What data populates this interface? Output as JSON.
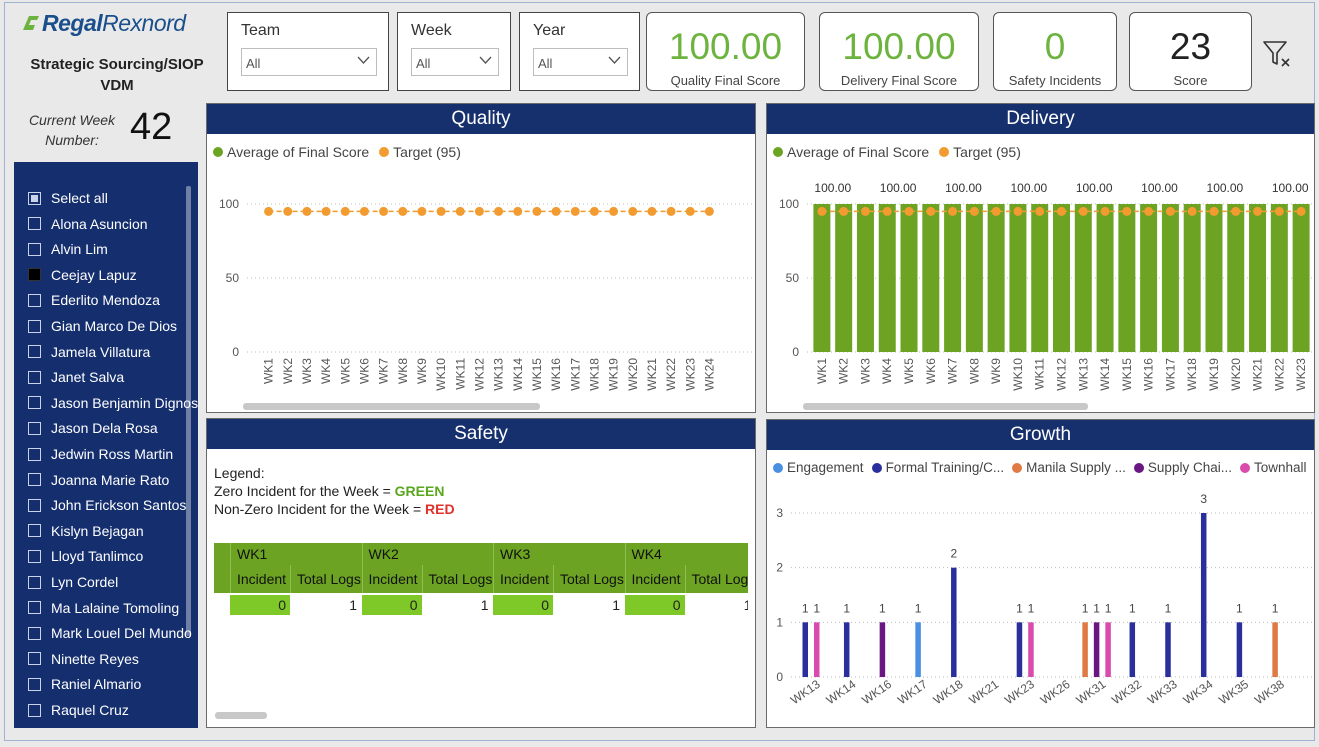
{
  "header": {
    "logo_text_bold": "Regal",
    "logo_text_rest": "Rexnord",
    "org_title": "Strategic Sourcing/SIOP VDM",
    "current_week_label": "Current Week Number:",
    "current_week_value": "42"
  },
  "slicers": [
    {
      "label": "Team",
      "value": "All"
    },
    {
      "label": "Week",
      "value": "All"
    },
    {
      "label": "Year",
      "value": "All"
    }
  ],
  "cards": [
    {
      "value": "100.00",
      "label": "Quality Final Score"
    },
    {
      "value": "100.00",
      "label": "Delivery Final Score"
    },
    {
      "value": "0",
      "label": "Safety Incidents"
    },
    {
      "value": "23",
      "label": "Score"
    }
  ],
  "people": {
    "items": [
      {
        "label": "Select all",
        "state": "partial"
      },
      {
        "label": "Alona Asuncion",
        "state": "none"
      },
      {
        "label": "Alvin Lim",
        "state": "none"
      },
      {
        "label": "Ceejay Lapuz",
        "state": "checked"
      },
      {
        "label": "Ederlito Mendoza",
        "state": "none"
      },
      {
        "label": "Gian Marco De Dios",
        "state": "none"
      },
      {
        "label": "Jamela Villatura",
        "state": "none"
      },
      {
        "label": "Janet Salva",
        "state": "none"
      },
      {
        "label": "Jason Benjamin Dignos",
        "state": "none"
      },
      {
        "label": "Jason Dela Rosa",
        "state": "none"
      },
      {
        "label": "Jedwin Ross Martin",
        "state": "none"
      },
      {
        "label": "Joanna Marie Rato",
        "state": "none"
      },
      {
        "label": "John Erickson Santos",
        "state": "none"
      },
      {
        "label": "Kislyn Bejagan",
        "state": "none"
      },
      {
        "label": "Lloyd Tanlimco",
        "state": "none"
      },
      {
        "label": "Lyn Cordel",
        "state": "none"
      },
      {
        "label": "Ma Lalaine Tomoling",
        "state": "none"
      },
      {
        "label": "Mark Louel Del Mundo",
        "state": "none"
      },
      {
        "label": "Ninette Reyes",
        "state": "none"
      },
      {
        "label": "Raniel Almario",
        "state": "none"
      },
      {
        "label": "Raquel Cruz",
        "state": "none"
      }
    ]
  },
  "colors": {
    "navy": "#162f6d",
    "score_green": "#6db33f",
    "bar_green": "#6ca322",
    "target_orange": "#f29b30",
    "avg_green": "#6ca322"
  },
  "panels": {
    "quality": {
      "title": "Quality"
    },
    "delivery": {
      "title": "Delivery"
    },
    "safety": {
      "title": "Safety"
    },
    "growth": {
      "title": "Growth"
    }
  },
  "safety": {
    "legend_title": "Legend:",
    "line1_prefix": "Zero Incident for the Week = ",
    "line1_value": "GREEN",
    "line2_prefix": "Non-Zero Incident for the Week = ",
    "line2_value": "RED",
    "weeks": [
      "WK1",
      "WK2",
      "WK3",
      "WK4"
    ],
    "col_headers": [
      "Incident",
      "Total Logs"
    ],
    "values": [
      {
        "incident": "0",
        "logs": "1"
      },
      {
        "incident": "0",
        "logs": "1"
      },
      {
        "incident": "0",
        "logs": "1"
      },
      {
        "incident": "0",
        "logs": "1"
      }
    ]
  },
  "chart_data": [
    {
      "id": "quality",
      "type": "line",
      "title": "Quality",
      "series": [
        {
          "name": "Average of Final Score",
          "values": []
        },
        {
          "name": "Target (95)",
          "values": [
            95,
            95,
            95,
            95,
            95,
            95,
            95,
            95,
            95,
            95,
            95,
            95,
            95,
            95,
            95,
            95,
            95,
            95,
            95,
            95,
            95,
            95,
            95,
            95
          ]
        }
      ],
      "categories": [
        "WK1",
        "WK2",
        "WK3",
        "WK4",
        "WK5",
        "WK6",
        "WK7",
        "WK8",
        "WK9",
        "WK10",
        "WK11",
        "WK12",
        "WK13",
        "WK14",
        "WK15",
        "WK16",
        "WK17",
        "WK18",
        "WK19",
        "WK20",
        "WK21",
        "WK22",
        "WK23",
        "WK24"
      ],
      "yticks": [
        "0",
        "50",
        "100"
      ],
      "ylim": [
        0,
        100
      ],
      "grid": true,
      "legend_position": "top-left"
    },
    {
      "id": "delivery",
      "type": "bar",
      "title": "Delivery",
      "categories": [
        "WK1",
        "WK2",
        "WK3",
        "WK4",
        "WK5",
        "WK6",
        "WK7",
        "WK8",
        "WK9",
        "WK10",
        "WK11",
        "WK12",
        "WK13",
        "WK14",
        "WK15",
        "WK16",
        "WK17",
        "WK18",
        "WK19",
        "WK20",
        "WK21",
        "WK22",
        "WK23"
      ],
      "series": [
        {
          "name": "Average of Final Score",
          "values": [
            100,
            100,
            100,
            100,
            100,
            100,
            100,
            100,
            100,
            100,
            100,
            100,
            100,
            100,
            100,
            100,
            100,
            100,
            100,
            100,
            100,
            100,
            100
          ]
        },
        {
          "name": "Target (95)",
          "values": [
            95,
            95,
            95,
            95,
            95,
            95,
            95,
            95,
            95,
            95,
            95,
            95,
            95,
            95,
            95,
            95,
            95,
            95,
            95,
            95,
            95,
            95,
            95
          ]
        }
      ],
      "data_labels": [
        "100.00",
        "100.00",
        "100.00",
        "100.00",
        "100.00",
        "100.00",
        "100.00",
        "100.00"
      ],
      "yticks": [
        "0",
        "50",
        "100"
      ],
      "ylim": [
        0,
        100
      ],
      "grid": true,
      "legend_position": "top-left"
    },
    {
      "id": "growth",
      "type": "bar",
      "title": "Growth",
      "categories": [
        "WK13",
        "WK14",
        "WK16",
        "WK17",
        "WK18",
        "WK21",
        "WK23",
        "WK26",
        "WK31",
        "WK32",
        "WK33",
        "WK34",
        "WK35",
        "WK38"
      ],
      "series": [
        {
          "name": "Engagement",
          "color": "#4a90e2",
          "values": [
            0,
            0,
            0,
            1,
            0,
            0,
            0,
            0,
            0,
            0,
            0,
            0,
            0,
            0
          ]
        },
        {
          "name": "Formal Training/C...",
          "color": "#2a2f9b",
          "values": [
            1,
            1,
            0,
            0,
            2,
            0,
            1,
            0,
            0,
            1,
            1,
            3,
            1,
            0
          ]
        },
        {
          "name": "Manila Supply ...",
          "color": "#e07a45",
          "values": [
            0,
            0,
            0,
            0,
            0,
            0,
            0,
            0,
            1,
            0,
            0,
            0,
            0,
            1
          ]
        },
        {
          "name": "Supply Chai...",
          "color": "#6b1783",
          "values": [
            0,
            0,
            1,
            0,
            0,
            0,
            0,
            0,
            1,
            0,
            0,
            0,
            0,
            0
          ]
        },
        {
          "name": "Townhall",
          "color": "#d94cae",
          "values": [
            1,
            0,
            0,
            0,
            0,
            0,
            1,
            0,
            1,
            0,
            0,
            0,
            0,
            0
          ]
        }
      ],
      "yticks": [
        "0",
        "1",
        "2",
        "3"
      ],
      "ylim": [
        0,
        3
      ],
      "grid": true,
      "legend_position": "top-left"
    }
  ]
}
